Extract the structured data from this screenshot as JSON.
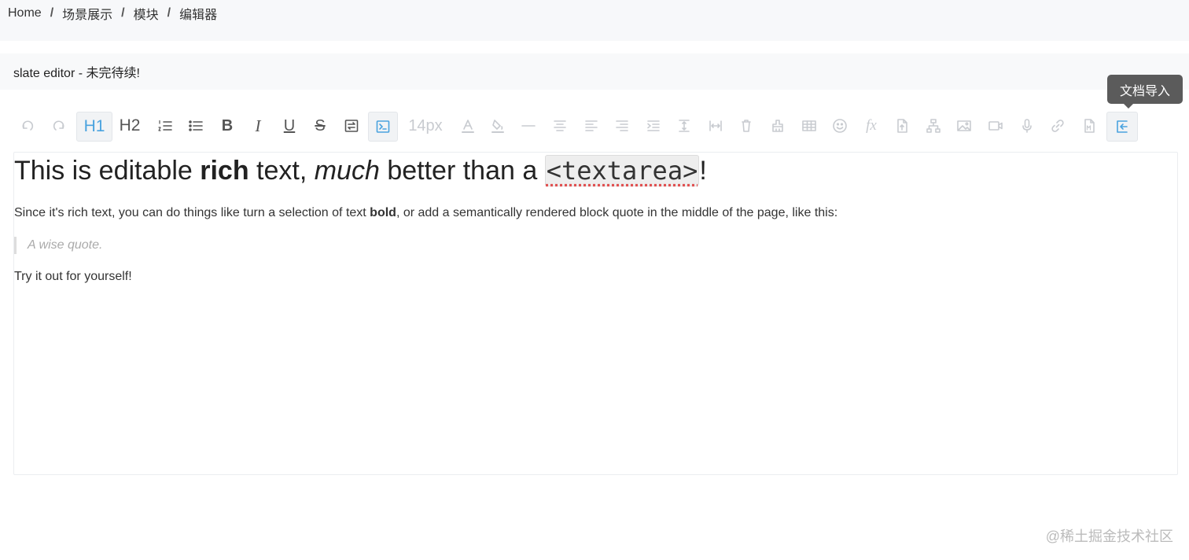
{
  "breadcrumb": [
    "Home",
    "场景展示",
    "模块",
    "编辑器"
  ],
  "breadcrumb_separator": "/",
  "page_title": "slate editor - 未完待续!",
  "toolbar": {
    "font_size": "14px",
    "h1": "H1",
    "h2": "H2",
    "bold": "B",
    "italic": "I",
    "underline": "U",
    "strike": "S",
    "fx": "fx",
    "buttons": [
      {
        "name": "undo-icon",
        "state": "disabled"
      },
      {
        "name": "redo-icon",
        "state": "disabled"
      },
      {
        "name": "heading-1",
        "state": "active"
      },
      {
        "name": "heading-2",
        "state": "normal"
      },
      {
        "name": "numbered-list-icon",
        "state": "normal"
      },
      {
        "name": "bulleted-list-icon",
        "state": "normal"
      },
      {
        "name": "bold",
        "state": "normal"
      },
      {
        "name": "italic",
        "state": "normal"
      },
      {
        "name": "underline",
        "state": "normal"
      },
      {
        "name": "strikethrough",
        "state": "normal"
      },
      {
        "name": "embed-icon",
        "state": "normal"
      },
      {
        "name": "code-block-icon",
        "state": "active"
      },
      {
        "name": "font-size",
        "state": "disabled"
      },
      {
        "name": "font-color-icon",
        "state": "disabled"
      },
      {
        "name": "fill-color-icon",
        "state": "disabled"
      },
      {
        "name": "horizontal-rule-icon",
        "state": "disabled"
      },
      {
        "name": "align-center-icon",
        "state": "disabled"
      },
      {
        "name": "align-left-icon",
        "state": "disabled"
      },
      {
        "name": "align-right-icon",
        "state": "disabled"
      },
      {
        "name": "indent-icon",
        "state": "disabled"
      },
      {
        "name": "line-height-icon",
        "state": "disabled"
      },
      {
        "name": "letter-spacing-icon",
        "state": "disabled"
      },
      {
        "name": "clear-format-icon",
        "state": "disabled"
      },
      {
        "name": "format-painter-icon",
        "state": "disabled"
      },
      {
        "name": "table-icon",
        "state": "disabled"
      },
      {
        "name": "emoji-icon",
        "state": "disabled"
      },
      {
        "name": "formula-icon",
        "state": "disabled"
      },
      {
        "name": "file-icon",
        "state": "disabled"
      },
      {
        "name": "org-chart-icon",
        "state": "disabled"
      },
      {
        "name": "image-icon",
        "state": "disabled"
      },
      {
        "name": "video-icon",
        "state": "disabled"
      },
      {
        "name": "audio-icon",
        "state": "disabled"
      },
      {
        "name": "link-icon",
        "state": "disabled"
      },
      {
        "name": "markdown-file-icon",
        "state": "disabled"
      },
      {
        "name": "document-import-icon",
        "state": "hover"
      }
    ]
  },
  "tooltip": "文档导入",
  "content": {
    "h1_part1": "This is editable ",
    "h1_bold": "rich",
    "h1_part2": " text, ",
    "h1_italic": "much",
    "h1_part3": " better than a ",
    "h1_code": "<textarea>",
    "h1_part4": "!",
    "p1_part1": "Since it's rich text, you can do things like turn a selection of text ",
    "p1_bold": "bold",
    "p1_part2": ", or add a semantically rendered block quote in the middle of the page, like this:",
    "quote": "A wise quote.",
    "p2": "Try it out for yourself!"
  },
  "watermark": "@稀土掘金技术社区",
  "colors": {
    "accent": "#4aa3df",
    "tooltip_bg": "#5b5b5b",
    "page_bg": "#f7f8fa",
    "disabled": "#c8cbd0"
  }
}
